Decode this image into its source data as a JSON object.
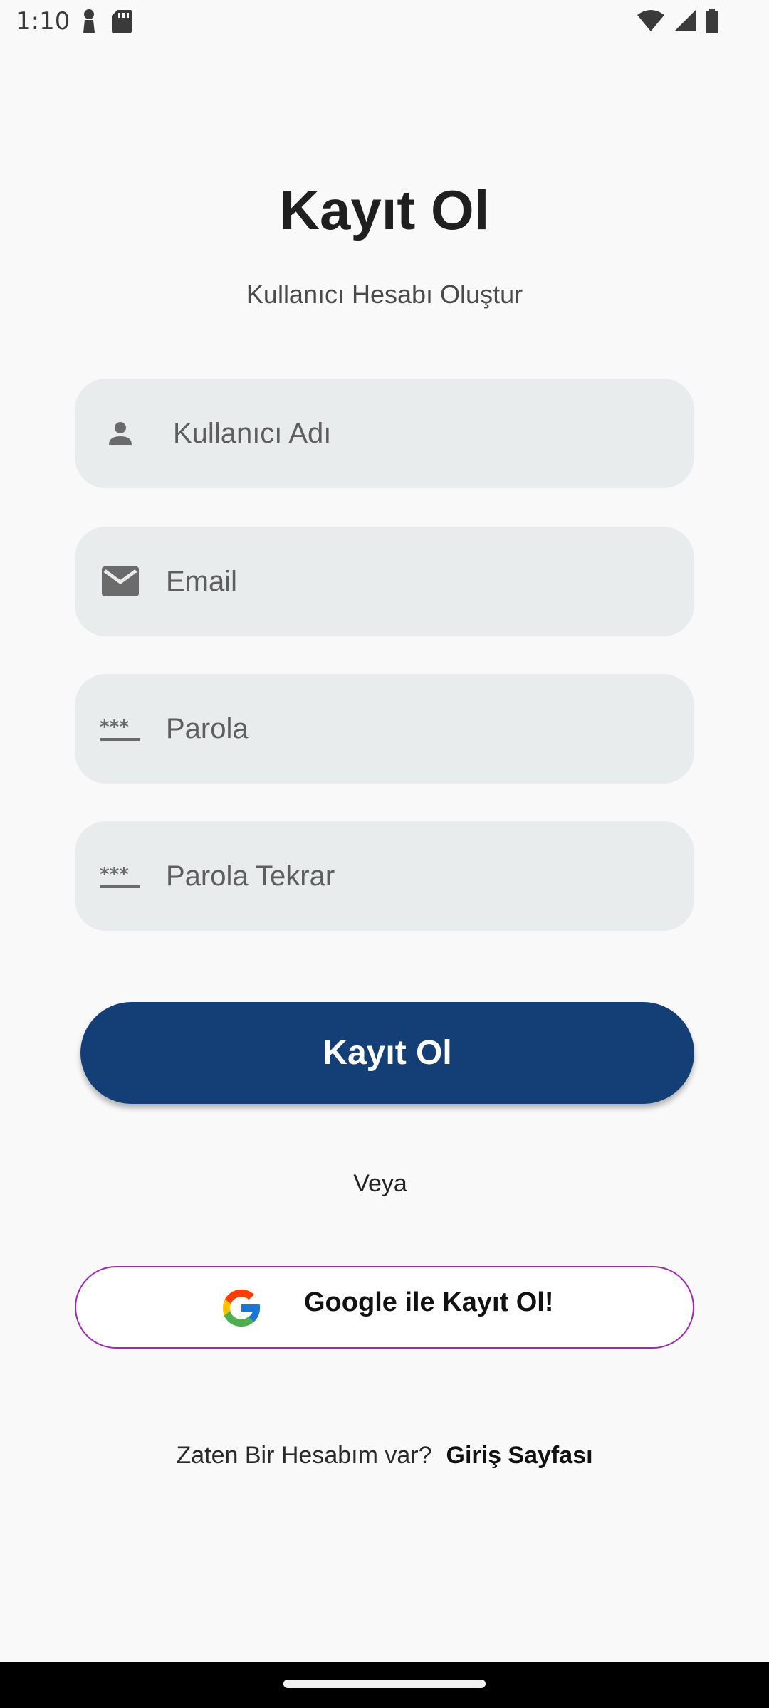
{
  "status_bar": {
    "time": "1:10",
    "left_icons": [
      "pawn-icon",
      "sd-card-icon"
    ],
    "right_icons": [
      "wifi-icon",
      "cell-signal-icon",
      "battery-icon"
    ]
  },
  "header": {
    "title": "Kayıt Ol",
    "subtitle": "Kullanıcı Hesabı Oluştur"
  },
  "form": {
    "username": {
      "placeholder": "Kullanıcı Adı",
      "icon": "person-icon"
    },
    "email": {
      "placeholder": "Email",
      "icon": "mail-icon"
    },
    "password": {
      "placeholder": "Parola",
      "icon": "password-icon"
    },
    "password_repeat": {
      "placeholder": "Parola Tekrar",
      "icon": "password-icon"
    }
  },
  "actions": {
    "register_label": "Kayıt Ol",
    "or_text": "Veya",
    "google_label": "Google ile Kayıt Ol!"
  },
  "footer": {
    "prompt": "Zaten Bir Hesabım var?",
    "login_link": "Giriş Sayfası"
  },
  "colors": {
    "background": "#f9f9f9",
    "field_background": "#e9ecec",
    "primary_button": "#143f76",
    "google_border": "#9b2bb2"
  }
}
